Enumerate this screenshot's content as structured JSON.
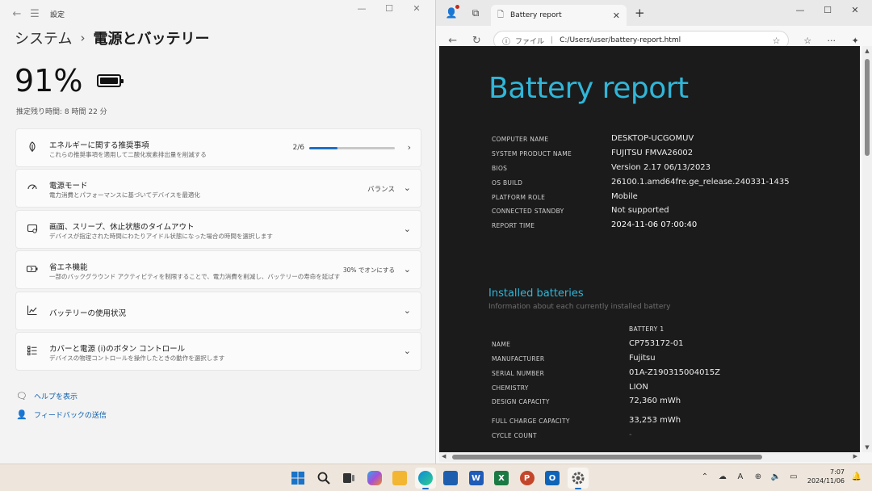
{
  "settings": {
    "app_name": "設定",
    "breadcrumb_parent": "システム",
    "breadcrumb_current": "電源とバッテリー",
    "battery_percent": "91%",
    "remaining_time": "推定残り時間: 8 時間 22 分",
    "cards": [
      {
        "title": "エネルギーに関する推奨事項",
        "desc": "これらの推奨事項を適用して二酸化炭素排出量を削減する",
        "progress_label": "2/6",
        "progress_fraction": 0.33
      },
      {
        "title": "電源モード",
        "desc": "電力消費とパフォーマンスに基づいてデバイスを最適化",
        "value": "バランス"
      },
      {
        "title": "画面、スリープ、休止状態のタイムアウト",
        "desc": "デバイスが指定された時間にわたりアイドル状態になった場合の時間を選択します"
      },
      {
        "title": "省エネ機能",
        "desc": "一部のバックグラウンド アクティビティを制限することで、電力消費を削減し、バッテリーの寿命を延ばす",
        "value": "30% でオンにする"
      },
      {
        "title": "バッテリーの使用状況",
        "desc": ""
      },
      {
        "title": "カバーと電源 (i)のボタン コントロール",
        "desc": "デバイスの物理コントロールを操作したときの動作を選択します"
      }
    ],
    "help_link": "ヘルプを表示",
    "feedback_link": "フィードバックの送信"
  },
  "edge": {
    "tab_title": "Battery report",
    "url_scheme": "ファイル",
    "url": "C:/Users/user/battery-report.html"
  },
  "report": {
    "title": "Battery report",
    "system_info": [
      {
        "key": "COMPUTER NAME",
        "value": "DESKTOP-UCGOMUV"
      },
      {
        "key": "SYSTEM PRODUCT NAME",
        "value": "FUJITSU FMVA26002"
      },
      {
        "key": "BIOS",
        "value": "Version 2.17 06/13/2023"
      },
      {
        "key": "OS BUILD",
        "value": "26100.1.amd64fre.ge_release.240331-1435"
      },
      {
        "key": "PLATFORM ROLE",
        "value": "Mobile"
      },
      {
        "key": "CONNECTED STANDBY",
        "value": "Not supported"
      },
      {
        "key": "REPORT TIME",
        "value": "2024-11-06  07:00:40"
      }
    ],
    "section_title": "Installed batteries",
    "section_subtitle": "Information about each currently installed battery",
    "column_header": "BATTERY 1",
    "battery_info": [
      {
        "key": "NAME",
        "value": "CP753172-01"
      },
      {
        "key": "MANUFACTURER",
        "value": "Fujitsu"
      },
      {
        "key": "SERIAL NUMBER",
        "value": "01A-Z190315004015Z"
      },
      {
        "key": "CHEMISTRY",
        "value": "LION"
      },
      {
        "key": "DESIGN CAPACITY",
        "value": "72,360 mWh"
      },
      {
        "key": "FULL CHARGE CAPACITY",
        "value": "33,253 mWh"
      },
      {
        "key": "CYCLE COUNT",
        "value": "-"
      }
    ]
  },
  "taskbar": {
    "time": "7:07",
    "date": "2024/11/06",
    "apps": [
      "windows-start",
      "search",
      "task-view",
      "copilot",
      "file-explorer",
      "edge",
      "store",
      "word",
      "excel",
      "powerpoint",
      "outlook",
      "settings"
    ]
  },
  "colors": {
    "accent_blue": "#1f6fc8",
    "report_cyan": "#30b6d8",
    "report_bg": "#1b1b1b"
  }
}
